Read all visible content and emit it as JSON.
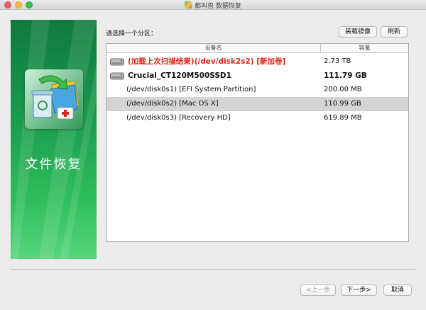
{
  "window": {
    "title": "都叫兽 数据恢复",
    "app_icon": "app-logo-icon"
  },
  "sidebar": {
    "caption": "文件恢复",
    "icon": "file-recovery-illustration-icon"
  },
  "main": {
    "prompt": "请选择一个分区：",
    "load_image_button": "装载镜像",
    "refresh_button": "刷新",
    "table": {
      "columns": {
        "name": "设备名",
        "size": "容量"
      },
      "rows": [
        {
          "name": "(加载上次扫描结果)(/dev/disk2s2) [新加卷]",
          "size": "2.73 TB",
          "style": "red",
          "icon": "hard-disk-icon",
          "selected": false
        },
        {
          "name": "Crucial_CT120M500SSD1",
          "size": "111.79 GB",
          "style": "bold",
          "icon": "hard-disk-icon",
          "selected": false
        },
        {
          "name": "(/dev/disk0s1) [EFI System Partition]",
          "size": "200.00 MB",
          "style": "normal",
          "icon": "",
          "selected": false
        },
        {
          "name": "(/dev/disk0s2) [Mac OS X]",
          "size": "110.99 GB",
          "style": "normal",
          "icon": "",
          "selected": true
        },
        {
          "name": "(/dev/disk0s3) [Recovery HD]",
          "size": "619.89 MB",
          "style": "normal",
          "icon": "",
          "selected": false
        }
      ]
    }
  },
  "footer": {
    "prev_button": "<上一步",
    "next_button": "下一步>",
    "cancel_button": "取消"
  },
  "colors": {
    "sidebar_green": "#1a9a4d",
    "highlight_red": "#e0241b",
    "selected_row": "#d4d4d4"
  }
}
